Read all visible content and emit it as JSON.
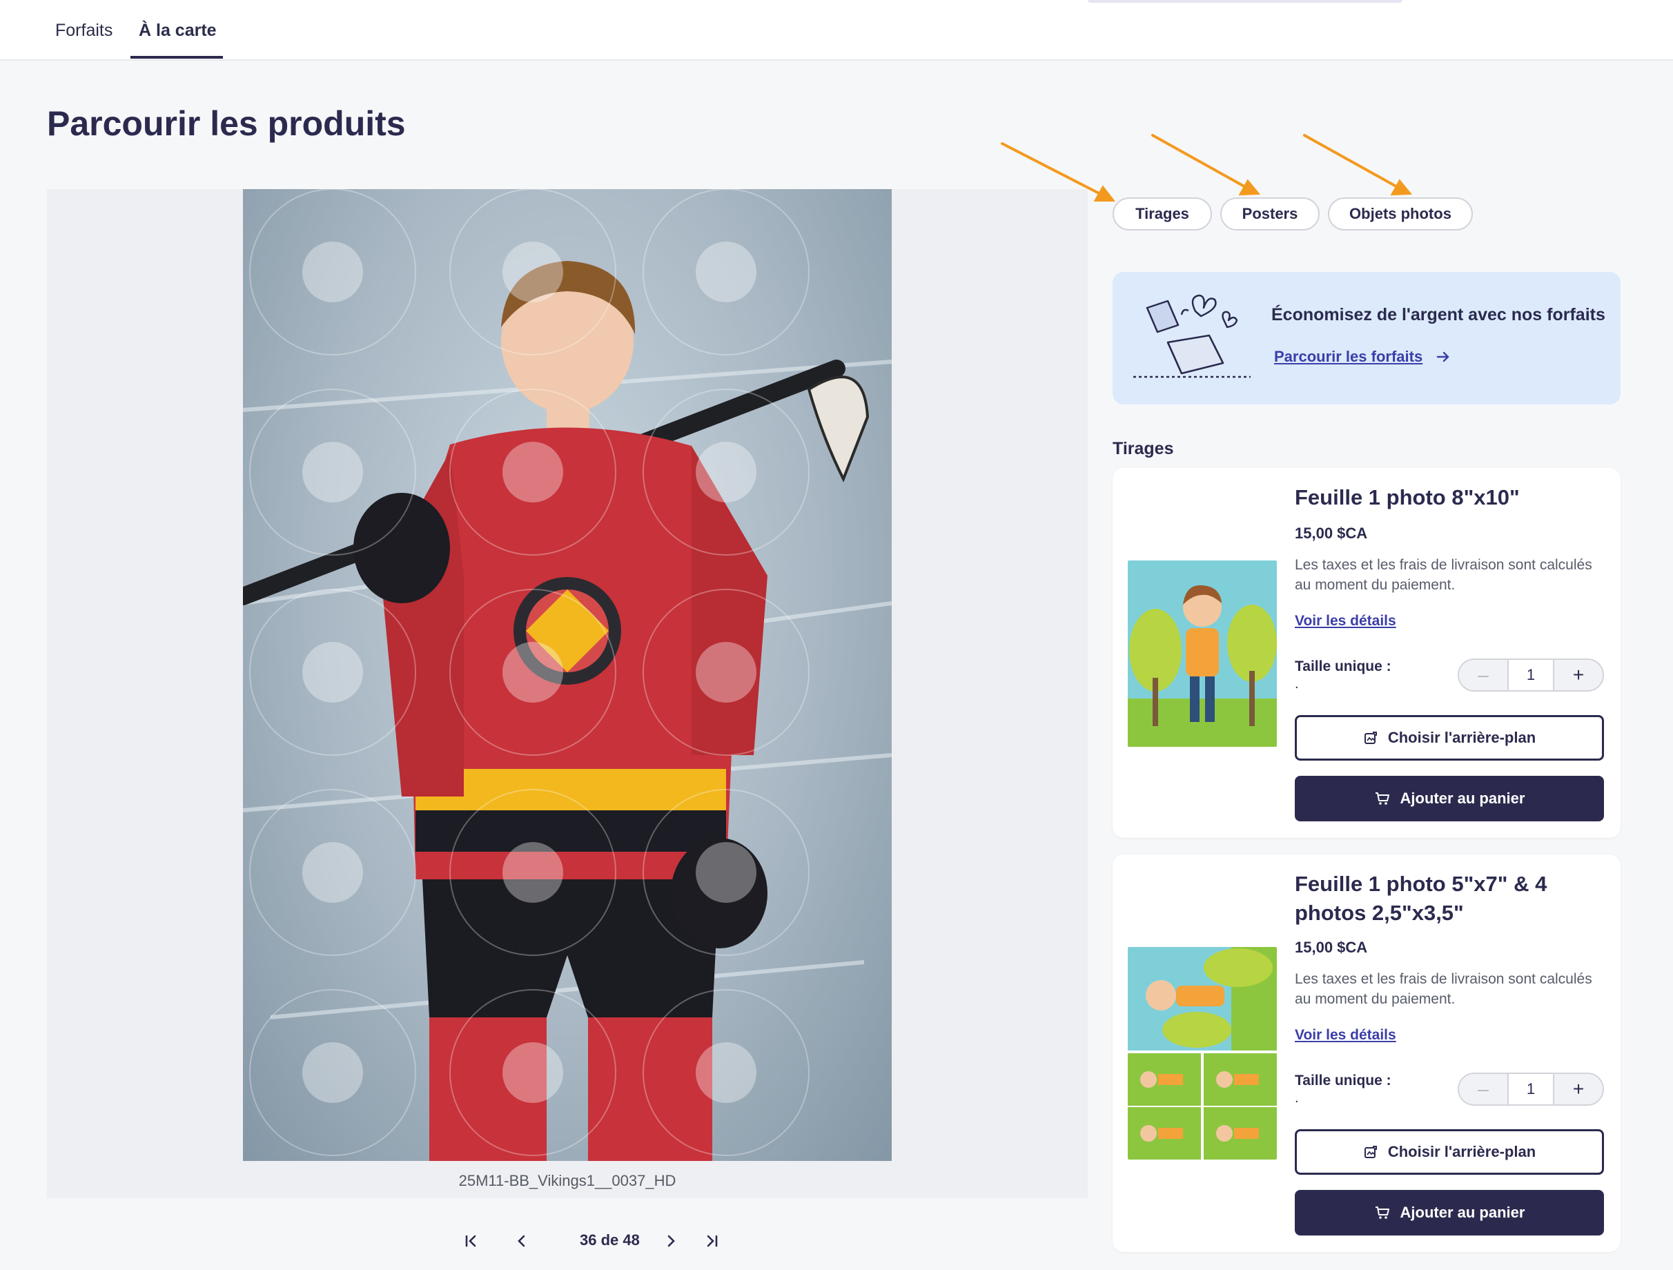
{
  "tabs": [
    {
      "label": "Forfaits",
      "active": false
    },
    {
      "label": "À la carte",
      "active": true
    }
  ],
  "page_title": "Parcourir les produits",
  "viewer": {
    "caption": "25M11-BB_Vikings1__0037_HD",
    "pager": {
      "current": "36 de 48"
    }
  },
  "filters": [
    "Tirages",
    "Posters",
    "Objets photos"
  ],
  "promo": {
    "title": "Économisez de l'argent avec nos forfaits",
    "link": "Parcourir les forfaits"
  },
  "section_label": "Tirages",
  "products": [
    {
      "title": "Feuille 1 photo 8\"x10\"",
      "price": "15,00 $CA",
      "description": "Les taxes et les frais de livraison sont calculés au moment du paiement.",
      "details_link": "Voir les détails",
      "size_label": "Taille unique :",
      "size_value": ".",
      "quantity": "1",
      "choose_bg_label": "Choisir l'arrière-plan",
      "add_to_cart_label": "Ajouter au panier"
    },
    {
      "title": "Feuille 1 photo 5\"x7\" & 4 photos 2,5\"x3,5\"",
      "price": "15,00 $CA",
      "description": "Les taxes et les frais de livraison sont calculés au moment du paiement.",
      "details_link": "Voir les détails",
      "size_label": "Taille unique :",
      "size_value": ".",
      "quantity": "1",
      "choose_bg_label": "Choisir l'arrière-plan",
      "add_to_cart_label": "Ajouter au panier"
    }
  ],
  "colors": {
    "primary": "#2b2a4e",
    "link": "#3b3ea8",
    "promo_bg": "#dceafb",
    "annotation_arrow": "#f39a1e",
    "jersey_red": "#c8323a"
  },
  "icons": [
    "first-page-icon",
    "prev-page-icon",
    "next-page-icon",
    "last-page-icon",
    "arrow-right-icon",
    "edit-image-icon",
    "cart-icon",
    "minus-icon",
    "plus-icon"
  ]
}
